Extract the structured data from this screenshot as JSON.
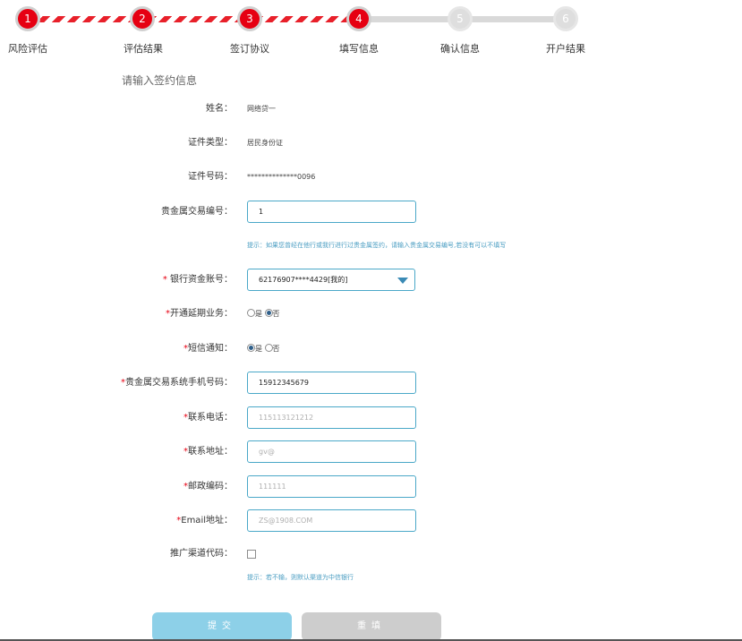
{
  "steps": [
    {
      "num": "1",
      "label": "风险评估",
      "state": "done"
    },
    {
      "num": "2",
      "label": "评估结果",
      "state": "done"
    },
    {
      "num": "3",
      "label": "签订协议",
      "state": "done"
    },
    {
      "num": "4",
      "label": "填写信息",
      "state": "current"
    },
    {
      "num": "5",
      "label": "确认信息",
      "state": "todo"
    },
    {
      "num": "6",
      "label": "开户结果",
      "state": "todo"
    }
  ],
  "colors": {
    "step_done": "#e60012",
    "step_todo": "#dedede",
    "input_border": "#4aa8c8",
    "hint": "#4a9dc2",
    "submit": "#8dd0e8",
    "reset": "#cdcdcd"
  },
  "form": {
    "title": "请输入签约信息",
    "name": {
      "label": "姓名：",
      "value": "网络贷一"
    },
    "id_type": {
      "label": "证件类型：",
      "value": "居民身份证"
    },
    "id_number": {
      "label": "证件号码：",
      "value": "**************0096"
    },
    "metal_trade_no": {
      "label": "贵金属交易编号：",
      "value": "1"
    },
    "metal_hint": "提示：如果您曾经在他行或我行进行过贵金属签约，请输入贵金属交易编号,若没有可以不填写",
    "bank_account": {
      "required": "* ",
      "label": "银行资金账号：",
      "selected": "62176907****4429[我的]"
    },
    "deferred": {
      "required": "*",
      "label": "开通延期业务：",
      "options": [
        "是",
        "否"
      ],
      "selected": "否"
    },
    "sms": {
      "required": "*",
      "label": "短信通知：",
      "options": [
        "是",
        "否"
      ],
      "selected": "是"
    },
    "mobile": {
      "required": "*",
      "label": "贵金属交易系统手机号码：",
      "value": "15912345679"
    },
    "phone": {
      "required": "*",
      "label": "联系电话：",
      "placeholder": "115113121212"
    },
    "address": {
      "required": "*",
      "label": "联系地址：",
      "placeholder": "gv@"
    },
    "postcode": {
      "required": "*",
      "label": "邮政编码：",
      "placeholder": "111111"
    },
    "email": {
      "required": "*",
      "label": "Email地址：",
      "placeholder": "ZS@1908.COM"
    },
    "channel": {
      "label": "推广渠道代码：",
      "checked": false
    },
    "channel_hint": "提示：若不输，则默认渠道为中信银行"
  },
  "buttons": {
    "submit": "提交",
    "reset": "重填"
  }
}
